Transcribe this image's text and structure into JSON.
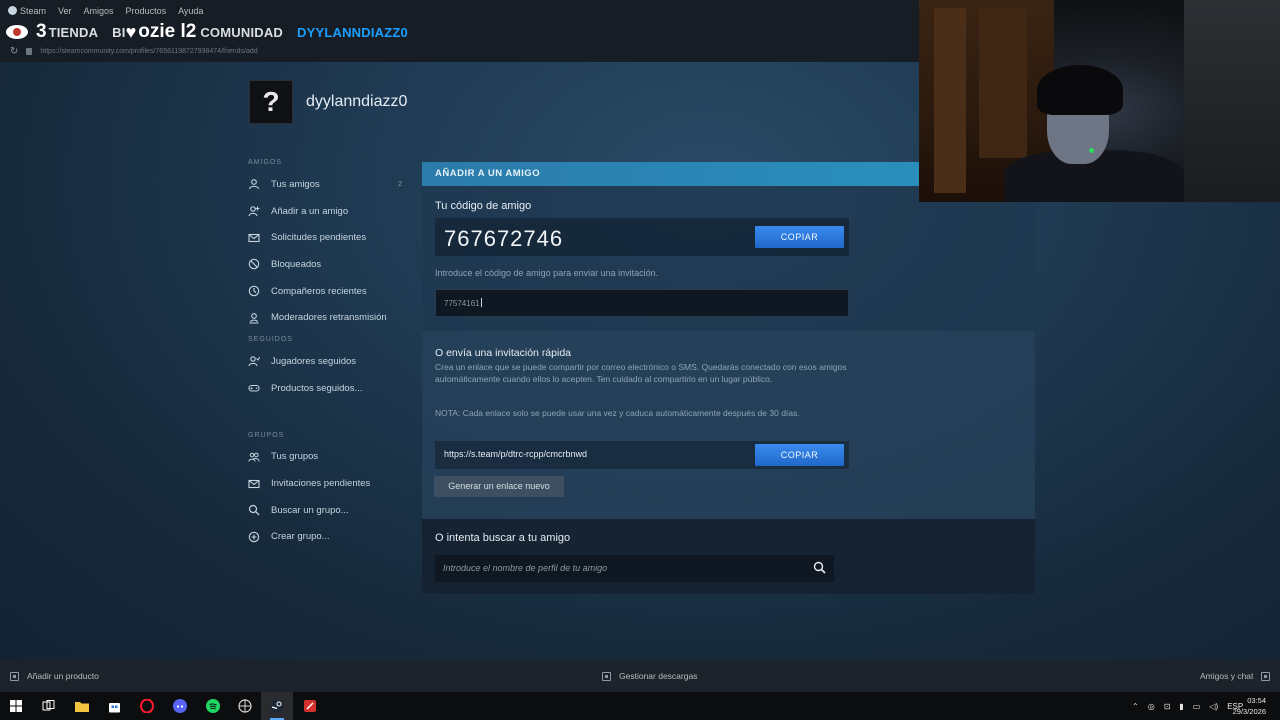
{
  "menubar": {
    "items": [
      "Steam",
      "Ver",
      "Amigos",
      "Productos",
      "Ayuda"
    ]
  },
  "overlay": {
    "viewer_count": "3",
    "username": "ozie l2"
  },
  "nav": {
    "tabs": [
      {
        "label": "TIENDA"
      },
      {
        "label": "BI"
      },
      {
        "label": "COMUNIDAD"
      },
      {
        "label": "DYYLANNDIAZZ0"
      }
    ]
  },
  "browser": {
    "url": "https://steamcommunity.com/profiles/76561198727938474/friends/add"
  },
  "profile": {
    "avatar_glyph": "?",
    "name": "dyylanndiazz0"
  },
  "sidebar": {
    "sections": [
      {
        "title": "AMIGOS",
        "items": [
          {
            "label": "Tus amigos",
            "icon": "person-icon",
            "count": "2"
          },
          {
            "label": "Añadir a un amigo",
            "icon": "person-add-icon"
          },
          {
            "label": "Solicitudes pendientes",
            "icon": "envelope-icon"
          },
          {
            "label": "Bloqueados",
            "icon": "blocked-icon"
          },
          {
            "label": "Compañeros recientes",
            "icon": "clock-icon"
          },
          {
            "label": "Moderadores retransmisión",
            "icon": "moderator-icon"
          }
        ]
      },
      {
        "title": "SEGUIDOS",
        "items": [
          {
            "label": "Jugadores seguidos",
            "icon": "person-follow-icon"
          },
          {
            "label": "Productos seguidos...",
            "icon": "gamepad-icon"
          }
        ]
      },
      {
        "title": "GRUPOS",
        "items": [
          {
            "label": "Tus grupos",
            "icon": "group-icon"
          },
          {
            "label": "Invitaciones pendientes",
            "icon": "envelope-icon"
          },
          {
            "label": "Buscar un grupo...",
            "icon": "search-icon"
          },
          {
            "label": "Crear grupo...",
            "icon": "plus-circle-icon"
          }
        ]
      }
    ]
  },
  "panel": {
    "header": "AÑADIR A UN AMIGO",
    "friend_code": {
      "title": "Tu código de amigo",
      "value": "767672746",
      "copy_label": "COPIAR",
      "hint": "Introduce el código de amigo para enviar una invitación.",
      "input_value": "77574161"
    },
    "quick_invite": {
      "title": "O envía una invitación rápida",
      "description": "Crea un enlace que se puede compartir por correo electrónico o SMS. Quedarás conectado con esos amigos automáticamente cuando ellos lo acepten. Ten cuidado al compartirlo en un lugar público.",
      "note": "NOTA: Cada enlace solo se puede usar una vez y caduca automáticamente después de 30 días.",
      "link": "https://s.team/p/dtrc-rcpp/cmcrbnwd",
      "copy_label": "COPIAR",
      "generate_label": "Generar un enlace nuevo"
    },
    "search": {
      "title": "O intenta buscar a tu amigo",
      "placeholder": "Introduce el nombre de perfil de tu amigo"
    }
  },
  "status_bar": {
    "add_product": "Añadir un producto",
    "downloads": "Gestionar descargas",
    "friends_chat": "Amigos y chat"
  },
  "taskbar": {
    "language": "ESP",
    "time": "03:54",
    "date": "29/3/2026"
  },
  "colors": {
    "accent_blue": "#1a9fff",
    "header_teal": "#2a8fbd",
    "copy_button": "#2d7ae0"
  }
}
